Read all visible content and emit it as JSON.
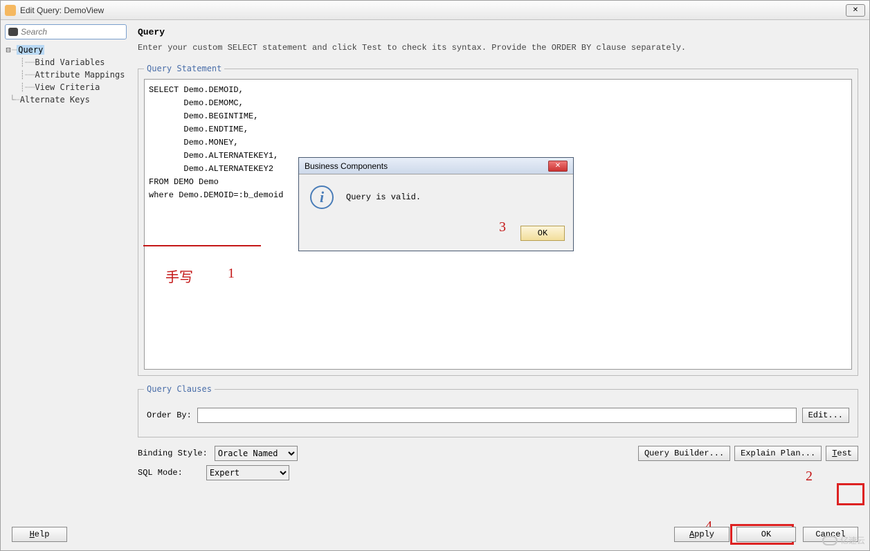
{
  "window": {
    "title": "Edit Query: DemoView",
    "close_glyph": "✕"
  },
  "sidebar": {
    "search_placeholder": "Search",
    "tree": {
      "root": "Query",
      "children": [
        "Bind Variables",
        "Attribute Mappings",
        "View Criteria"
      ],
      "alt_keys": "Alternate Keys"
    }
  },
  "main": {
    "heading": "Query",
    "description": "Enter your custom SELECT statement and click Test to check its syntax.  Provide the ORDER BY clause separately.",
    "statement_legend": "Query Statement",
    "query_text": "SELECT Demo.DEMOID,\n       Demo.DEMOMC,\n       Demo.BEGINTIME,\n       Demo.ENDTIME,\n       Demo.MONEY,\n       Demo.ALTERNATEKEY1,\n       Demo.ALTERNATEKEY2\nFROM DEMO Demo\nwhere Demo.DEMOID=:b_demoid",
    "clauses_legend": "Query Clauses",
    "order_by_label": "Order By:",
    "order_by_value": "",
    "edit_button": "Edit...",
    "binding_style_label": "Binding Style:",
    "binding_style_value": "Oracle Named",
    "sql_mode_label": "SQL Mode:",
    "sql_mode_value": "Expert",
    "query_builder_button": "Query Builder...",
    "explain_plan_button": "Explain Plan...",
    "test_button": "Test"
  },
  "modal": {
    "title": "Business Components",
    "message": "Query is valid.",
    "ok_button": "OK",
    "close_glyph": "✕"
  },
  "footer": {
    "help_button": "Help",
    "apply_button": "Apply",
    "ok_button": "OK",
    "cancel_button": "Cancel"
  },
  "annotations": {
    "hand": "手写",
    "n1": "1",
    "n2": "2",
    "n3": "3",
    "n4": "4"
  },
  "watermark": "亿速云"
}
